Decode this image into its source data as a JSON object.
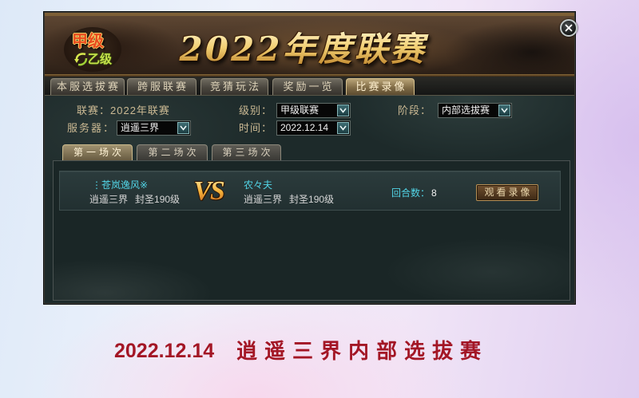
{
  "colors": {
    "accent_cyan": "#52d4e6",
    "label_tan": "#cbb993",
    "caption_red": "#a31625",
    "title_gold": "#f2cf73"
  },
  "icons": {
    "close": "close-icon",
    "dropdown": "chevron-down-icon",
    "logo_arrow": "swap-arrow-icon"
  },
  "banner": {
    "logo": {
      "top": "甲级",
      "bottom": "乙级"
    },
    "title": "2022年度联赛"
  },
  "tabs": [
    {
      "label": "本服选拔赛",
      "active": false
    },
    {
      "label": "跨服联赛",
      "active": false
    },
    {
      "label": "竞猜玩法",
      "active": false
    },
    {
      "label": "奖励一览",
      "active": false
    },
    {
      "label": "比赛录像",
      "active": true
    }
  ],
  "filters": {
    "league": {
      "label": "联赛：",
      "value": "2022年联赛"
    },
    "level": {
      "label": "级别：",
      "value": "甲级联赛"
    },
    "stage": {
      "label": "阶段：",
      "value": "内部选拔赛"
    },
    "server": {
      "label": "服务器：",
      "value": "逍遥三界"
    },
    "time": {
      "label": "时间：",
      "value": "2022.12.14"
    }
  },
  "sessions": [
    {
      "label": "第一场次",
      "active": true
    },
    {
      "label": "第二场次",
      "active": false
    },
    {
      "label": "第三场次",
      "active": false
    }
  ],
  "matches": [
    {
      "player1": {
        "name": "⋮苍岚逸风※",
        "server": "逍遥三界",
        "rank": "封圣190级"
      },
      "vs": "VS",
      "player2": {
        "name": "农々夫",
        "server": "逍遥三界",
        "rank": "封圣190级"
      },
      "rounds_label": "回合数：",
      "rounds_value": "8",
      "watch_label": "观看录像"
    }
  ],
  "caption": {
    "date": "2022.12.14",
    "title": "逍遥三界内部选拔赛"
  }
}
